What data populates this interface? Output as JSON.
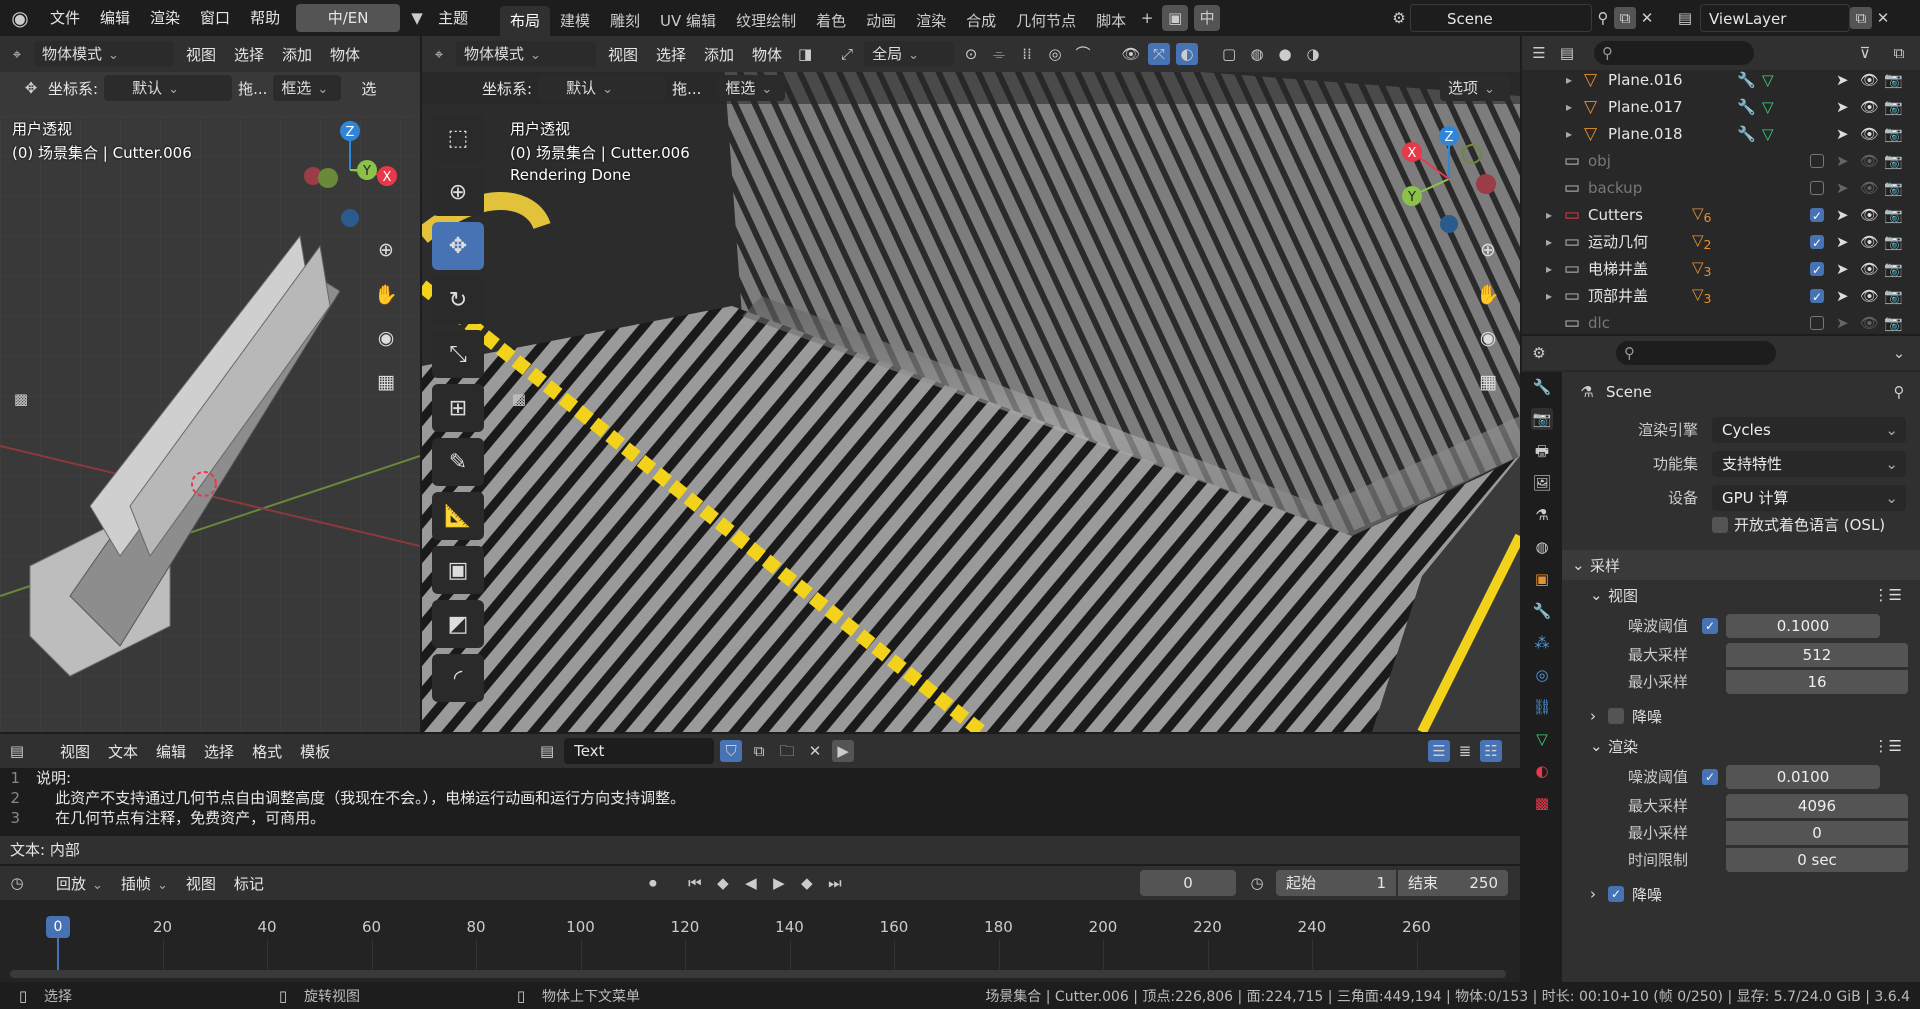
{
  "topbar": {
    "menus": [
      "文件",
      "编辑",
      "渲染",
      "窗口",
      "帮助"
    ],
    "lang_button": "中/EN",
    "theme": "主题",
    "workspaces": [
      "布局",
      "建模",
      "雕刻",
      "UV 编辑",
      "纹理绘制",
      "着色",
      "动画",
      "渲染",
      "合成",
      "几何节点",
      "脚本"
    ],
    "active_workspace": "布局",
    "scene_name": "Scene",
    "view_layer": "ViewLayer"
  },
  "left_view": {
    "mode": "物体模式",
    "menus": [
      "视图",
      "选择",
      "添加",
      "物体"
    ],
    "coord_label": "坐标系:",
    "coord_value": "默认",
    "drag_label": "拖...",
    "select_mode": "框选",
    "extra": "选",
    "persp": "用户透视",
    "collection": "(0) 场景集合 | Cutter.006"
  },
  "main_view": {
    "mode": "物体模式",
    "menus": [
      "视图",
      "选择",
      "添加",
      "物体"
    ],
    "orientation": "全局",
    "coord_label": "坐标系:",
    "coord_value": "默认",
    "drag_label": "拖...",
    "select_mode": "框选",
    "options": "选项",
    "persp": "用户透视",
    "collection": "(0) 场景集合 | Cutter.006",
    "status": "Rendering Done"
  },
  "text_editor": {
    "menus": [
      "视图",
      "文本",
      "编辑",
      "选择",
      "格式",
      "模板"
    ],
    "file_name": "Text",
    "lines": [
      {
        "n": "1",
        "t": "说明:"
      },
      {
        "n": "2",
        "t": "    此资产不支持通过几何节点自由调整高度（我现在不会。），电梯运行动画和运行方向支持调整。"
      },
      {
        "n": "3",
        "t": "    在几何节点有注释，免费资产，可商用。"
      }
    ],
    "footer": "文本: 内部"
  },
  "timeline": {
    "menus": [
      "回放",
      "插帧",
      "视图",
      "标记"
    ],
    "current_frame": "0",
    "start_label": "起始",
    "start": "1",
    "end_label": "结束",
    "end": "250",
    "ticks": [
      "0",
      "20",
      "40",
      "60",
      "80",
      "100",
      "120",
      "140",
      "160",
      "180",
      "200",
      "220",
      "240",
      "260"
    ]
  },
  "outliner": {
    "rows": [
      {
        "name": "Plane.016",
        "kind": "mesh",
        "indent": 1,
        "checkbox": false,
        "dim": false
      },
      {
        "name": "Plane.017",
        "kind": "mesh",
        "indent": 1,
        "checkbox": false,
        "dim": false
      },
      {
        "name": "Plane.018",
        "kind": "mesh",
        "indent": 1,
        "checkbox": false,
        "dim": false
      },
      {
        "name": "obj",
        "kind": "coll",
        "indent": 0,
        "checkbox": true,
        "checked": false,
        "dim": true,
        "badge": ""
      },
      {
        "name": "backup",
        "kind": "coll",
        "indent": 0,
        "checkbox": true,
        "checked": false,
        "dim": true,
        "badge": ""
      },
      {
        "name": "Cutters",
        "kind": "coll-red",
        "indent": 0,
        "checkbox": true,
        "checked": true,
        "dim": false,
        "badge": "6"
      },
      {
        "name": "运动几何",
        "kind": "coll",
        "indent": 0,
        "checkbox": true,
        "checked": true,
        "dim": false,
        "badge": "2"
      },
      {
        "name": "电梯井盖",
        "kind": "coll",
        "indent": 0,
        "checkbox": true,
        "checked": true,
        "dim": false,
        "badge": "3"
      },
      {
        "name": "顶部井盖",
        "kind": "coll",
        "indent": 0,
        "checkbox": true,
        "checked": true,
        "dim": false,
        "badge": "3"
      },
      {
        "name": "dlc",
        "kind": "coll",
        "indent": 0,
        "checkbox": true,
        "checked": false,
        "dim": true,
        "badge": ""
      }
    ]
  },
  "properties": {
    "title": "Scene",
    "render_engine_label": "渲染引擎",
    "render_engine": "Cycles",
    "feature_set_label": "功能集",
    "feature_set": "支持特性",
    "device_label": "设备",
    "device": "GPU 计算",
    "osl_label": "开放式着色语言 (OSL)",
    "sampling": "采样",
    "viewport": "视图",
    "noise_threshold_label": "噪波阈值",
    "vp_noise_threshold": "0.1000",
    "max_samples_label": "最大采样",
    "vp_max_samples": "512",
    "min_samples_label": "最小采样",
    "vp_min_samples": "16",
    "denoise_label": "降噪",
    "render": "渲染",
    "r_noise_threshold": "0.0100",
    "r_max_samples": "4096",
    "r_min_samples": "0",
    "time_limit_label": "时间限制",
    "time_limit": "0 sec"
  },
  "statusbar": {
    "select": "选择",
    "rotate": "旋转视图",
    "context": "物体上下文菜单",
    "info": "场景集合 | Cutter.006 | 顶点:226,806 | 面:224,715 | 三角面:449,194 | 物体:0/153 | 时长: 00:10+10 (帧 0/250) | 显存: 5.7/24.0 GiB | 3.6.4"
  },
  "colors": {
    "accent": "#4772b3",
    "yellow": "#f2d21b",
    "red_axis": "#e8394b",
    "green_axis": "#8bc34a",
    "blue_axis": "#2f86d8"
  }
}
